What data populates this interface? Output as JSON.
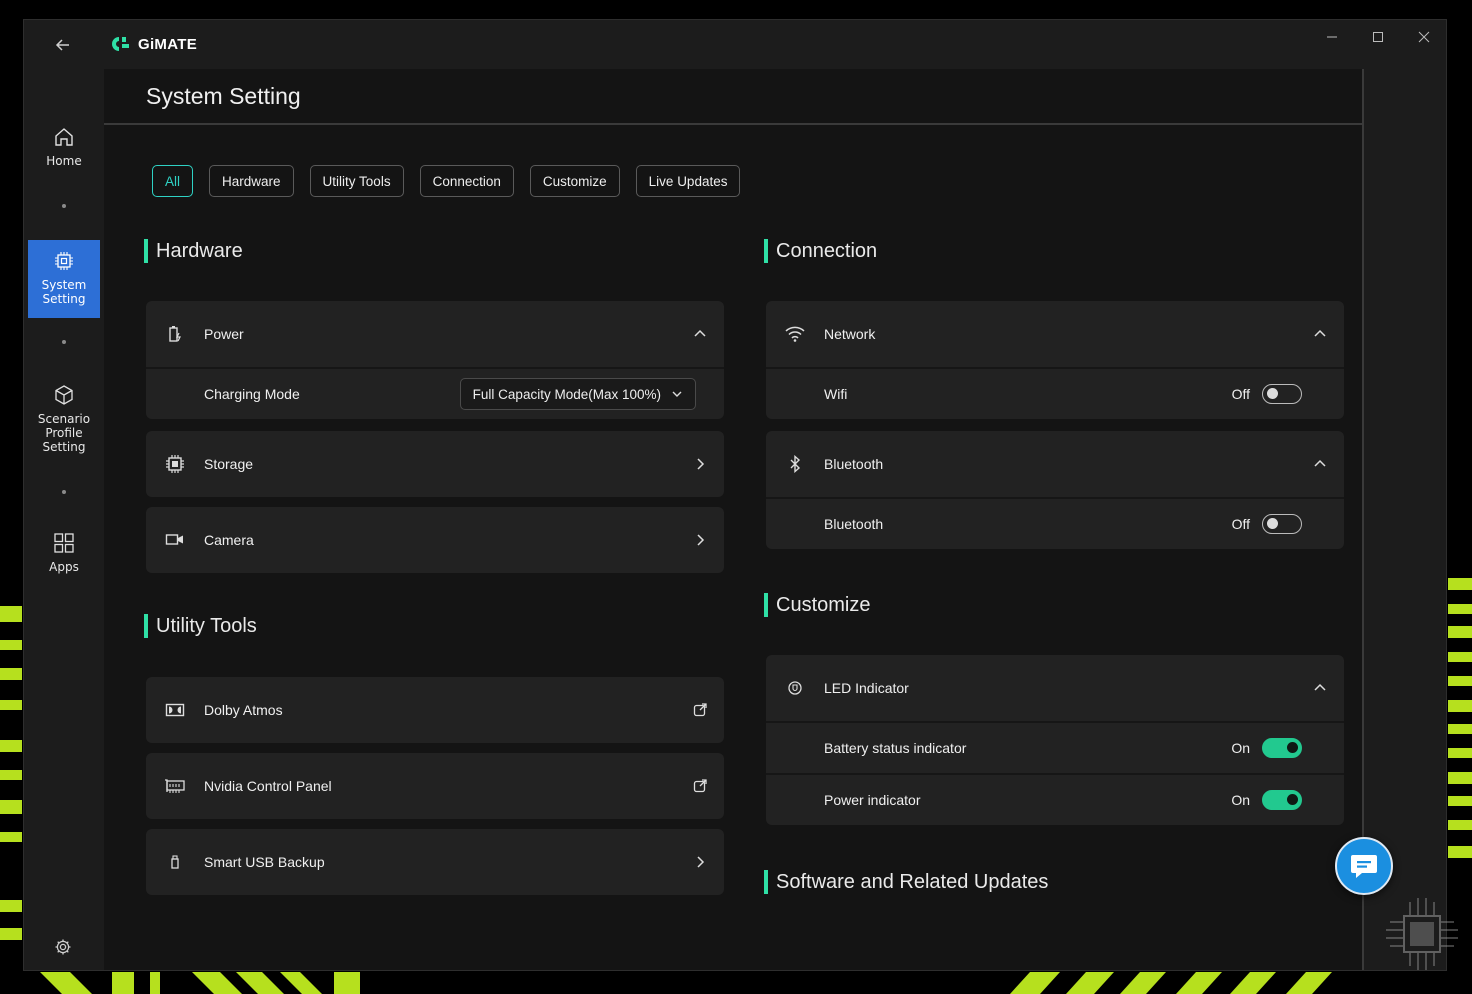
{
  "app": {
    "name": "GiMATE"
  },
  "window_controls": {
    "minimize_icon": "minimize-icon",
    "maximize_icon": "maximize-icon",
    "close_icon": "close-icon"
  },
  "sidebar": {
    "items": [
      {
        "label": "Home",
        "icon": "home-icon",
        "active": false
      },
      {
        "label": "System\nSetting",
        "icon": "chip-icon",
        "active": true
      },
      {
        "label": "Scenario\nProfile\nSetting",
        "icon": "cube-icon",
        "active": false
      },
      {
        "label": "Apps",
        "icon": "apps-grid-icon",
        "active": false
      }
    ],
    "settings_icon": "gear-icon"
  },
  "page": {
    "title": "System Setting"
  },
  "filters": [
    {
      "label": "All",
      "active": true
    },
    {
      "label": "Hardware",
      "active": false
    },
    {
      "label": "Utility Tools",
      "active": false
    },
    {
      "label": "Connection",
      "active": false
    },
    {
      "label": "Customize",
      "active": false
    },
    {
      "label": "Live Updates",
      "active": false
    }
  ],
  "hardware": {
    "title": "Hardware",
    "power": {
      "label": "Power",
      "charging_mode_label": "Charging Mode",
      "charging_mode_value": "Full Capacity Mode(Max 100%)"
    },
    "storage": {
      "label": "Storage"
    },
    "camera": {
      "label": "Camera"
    }
  },
  "utility": {
    "title": "Utility Tools",
    "dolby": {
      "label": "Dolby Atmos"
    },
    "nvidia": {
      "label": "Nvidia Control Panel"
    },
    "usb": {
      "label": "Smart USB Backup"
    }
  },
  "connection": {
    "title": "Connection",
    "network": {
      "label": "Network",
      "wifi_label": "Wifi",
      "wifi_state": "Off"
    },
    "bluetooth": {
      "label": "Bluetooth",
      "bt_label": "Bluetooth",
      "bt_state": "Off"
    }
  },
  "customize": {
    "title": "Customize",
    "led": {
      "label": "LED Indicator",
      "battery_label": "Battery status indicator",
      "battery_state": "On",
      "power_label": "Power indicator",
      "power_state": "On"
    }
  },
  "updates": {
    "title": "Software and Related Updates"
  },
  "colors": {
    "accent": "#2fe0a6",
    "active_nav": "#2d6fd6",
    "toggle_on": "#22c98f",
    "filter_active": "#2fd2c4",
    "wallpaper": "#b6e01e"
  }
}
